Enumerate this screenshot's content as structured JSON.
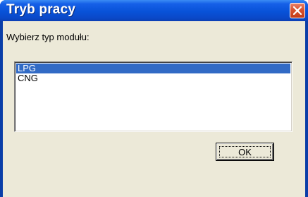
{
  "window": {
    "title": "Tryb pracy",
    "close_icon": "close-icon"
  },
  "dialog": {
    "prompt": "Wybierz typ modułu:",
    "list": {
      "items": [
        {
          "label": "LPG",
          "selected": true
        },
        {
          "label": "CNG",
          "selected": false
        }
      ]
    },
    "ok_label": "OK"
  },
  "colors": {
    "titlebar": "#0852d8",
    "client": "#ece9d8",
    "selection": "#316ac5",
    "close_button": "#d8522e"
  }
}
